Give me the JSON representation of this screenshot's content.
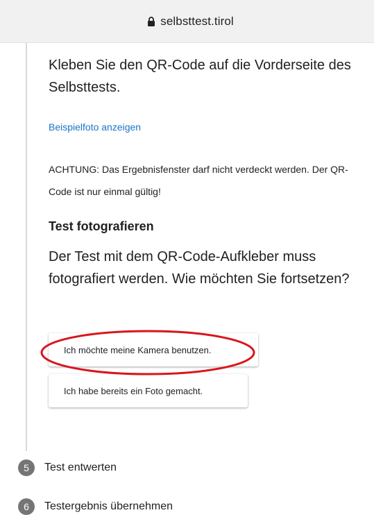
{
  "browser": {
    "url": "selbsttest.tirol",
    "lock_icon": "lock-icon"
  },
  "main": {
    "instruction": "Kleben Sie den QR-Code auf die Vorderseite des Selbsttests.",
    "example_link": "Beispielfoto anzeigen",
    "warning": "ACHTUNG: Das Ergebnisfenster darf nicht verdeckt werden. Der QR-Code ist nur einmal gültig!",
    "section_title": "Test fotografieren",
    "section_desc": "Der Test mit dem QR-Code-Aufkleber muss fotografiert werden. Wie möchten Sie fortsetzen?",
    "buttons": {
      "camera": "Ich möchte meine Kamera benutzen.",
      "photo": "Ich habe bereits ein Foto gemacht."
    },
    "highlight_color": "#d9151c"
  },
  "steps": [
    {
      "number": "5",
      "label": "Test entwerten"
    },
    {
      "number": "6",
      "label": "Testergebnis übernehmen"
    }
  ],
  "colors": {
    "link": "#1a73c8",
    "step_badge": "#757575",
    "urlbar": "#f1f1f1"
  }
}
